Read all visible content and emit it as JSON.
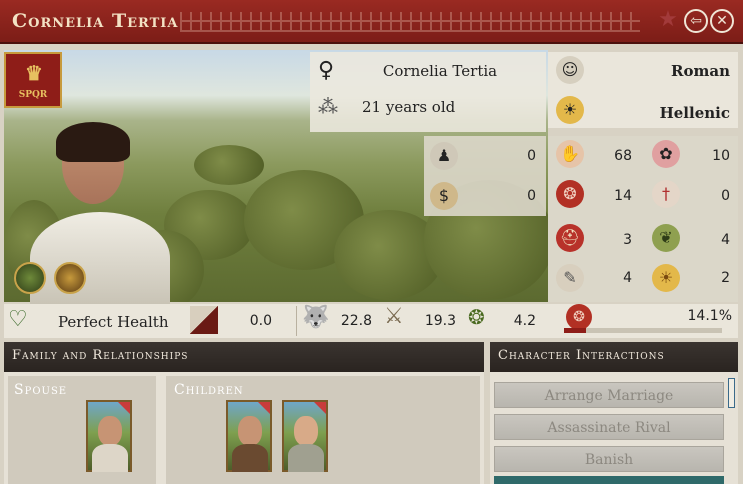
{
  "window": {
    "title": "Cornelia Tertia"
  },
  "character": {
    "name": "Cornelia Tertia",
    "age": "21 years old",
    "culture": "Roman",
    "religion": "Hellenic",
    "gender_icon": "female-symbol-icon",
    "faction_emblem_text": "SPQR"
  },
  "mid_stats": [
    {
      "icon": "loyalty-icon",
      "value": "0"
    },
    {
      "icon": "wealth-bag-icon",
      "value": "0"
    }
  ],
  "right_stats": [
    {
      "icon": "hand-icon",
      "value": "68"
    },
    {
      "icon": "flower-icon",
      "value": "10"
    },
    {
      "icon": "seal-icon",
      "value": "14"
    },
    {
      "icon": "dagger-icon",
      "value": "0"
    },
    {
      "icon": "helmet-icon",
      "value": "3"
    },
    {
      "icon": "laurel-icon",
      "value": "4"
    },
    {
      "icon": "scroll-icon",
      "value": "4"
    },
    {
      "icon": "sun-icon",
      "value": "2"
    }
  ],
  "status_row": {
    "health": "Perfect Health",
    "prominence": "0.0",
    "martial": "22.8",
    "finesse": "19.3",
    "zeal": "4.2",
    "popularity": "14.1%"
  },
  "family": {
    "header": "Family and Relationships",
    "spouse_label": "Spouse",
    "children_label": "Children"
  },
  "interactions": {
    "header": "Character Interactions",
    "actions": [
      "Arrange Marriage",
      "Assassinate Rival",
      "Banish"
    ]
  }
}
